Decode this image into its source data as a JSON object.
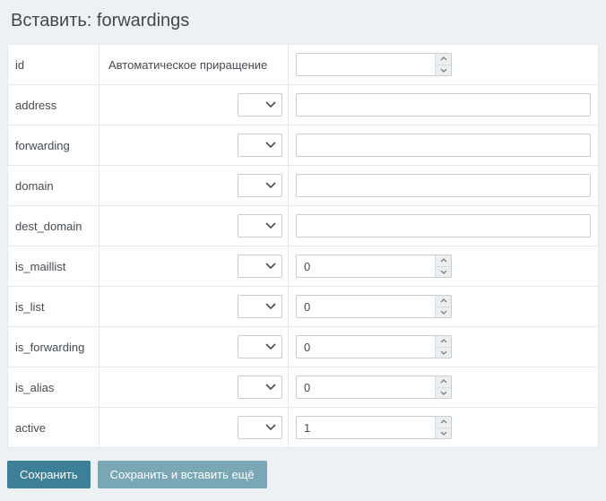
{
  "title": "Вставить: forwardings",
  "auto_increment_label": "Автоматическое приращение",
  "fields": {
    "id": {
      "label": "id",
      "kind": "auto",
      "value": ""
    },
    "address": {
      "label": "address",
      "kind": "text",
      "value": ""
    },
    "forwarding": {
      "label": "forwarding",
      "kind": "text",
      "value": ""
    },
    "domain": {
      "label": "domain",
      "kind": "text",
      "value": ""
    },
    "dest_domain": {
      "label": "dest_domain",
      "kind": "text",
      "value": ""
    },
    "is_maillist": {
      "label": "is_maillist",
      "kind": "number",
      "value": "0"
    },
    "is_list": {
      "label": "is_list",
      "kind": "number",
      "value": "0"
    },
    "is_forwarding": {
      "label": "is_forwarding",
      "kind": "number",
      "value": "0"
    },
    "is_alias": {
      "label": "is_alias",
      "kind": "number",
      "value": "0"
    },
    "active": {
      "label": "active",
      "kind": "number",
      "value": "1"
    }
  },
  "buttons": {
    "save": "Сохранить",
    "save_and_more": "Сохранить и вставить ещё"
  },
  "colors": {
    "primary": "#3d7f97",
    "secondary": "#7aa7b5"
  }
}
